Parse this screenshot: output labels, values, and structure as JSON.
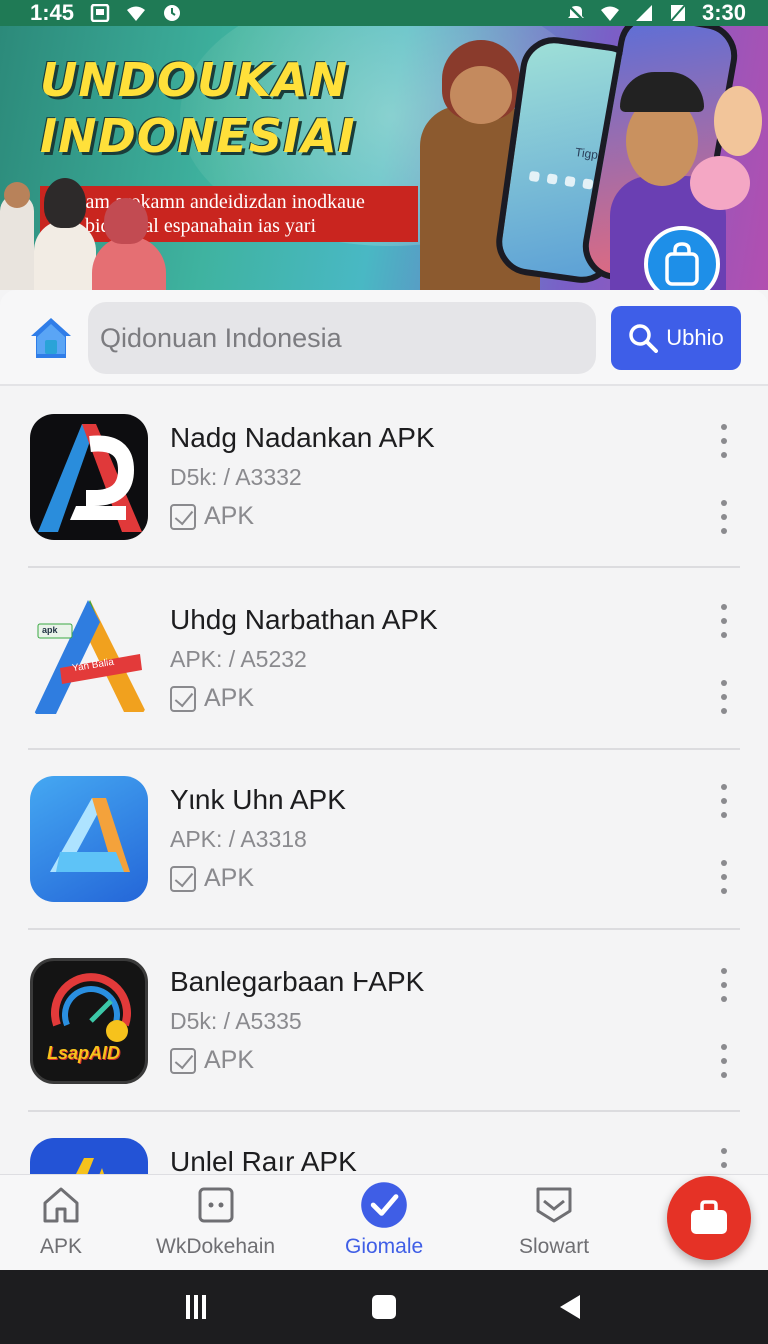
{
  "status_bar": {
    "time_left": "1:45",
    "time_right": "3:30"
  },
  "banner": {
    "title_line1": "UNDOUKAN",
    "title_line2": "INDONESIAI",
    "subtitle_line1": "Narlam arokamn andeidizdan inodkaue",
    "subtitle_line2": "uon bide letal espanahain ias yari",
    "phone_screen_text": "Tigpc"
  },
  "search": {
    "placeholder": "Qidonuan Indonesia",
    "button_label": "Ubhio"
  },
  "apps": [
    {
      "name": "Nadg Nadankan APK",
      "version": "D5k: / A3332",
      "type": "APK"
    },
    {
      "name": "Uhdg Narbathan APK",
      "version": "APK: / A5232",
      "type": "APK",
      "icon_badge_top": "apk",
      "icon_ribbon": "Yan Balia"
    },
    {
      "name": "Yιnk Uhn APK",
      "version": "APK: / A3318",
      "type": "APK"
    },
    {
      "name": "Banlegarbaan ⱵAPK",
      "version": "D5k: / A5335",
      "type": "APK",
      "icon_text": "LsapAID"
    },
    {
      "name": "Unlel Raır APK"
    }
  ],
  "bottom_nav": {
    "items": [
      {
        "label": "APK",
        "icon": "home-outline-icon"
      },
      {
        "label": "WkDokehain",
        "icon": "square-dots-icon"
      },
      {
        "label": "Giomale",
        "icon": "check-circle-icon"
      },
      {
        "label": "Slowart",
        "icon": "shield-chevron-icon"
      }
    ],
    "active_index": 2
  },
  "colors": {
    "accent": "#3e5ee8",
    "fab": "#e53226",
    "status_bar": "#1f7a55",
    "banner_title": "#ffe03a",
    "banner_ribbon": "#c9251f"
  }
}
